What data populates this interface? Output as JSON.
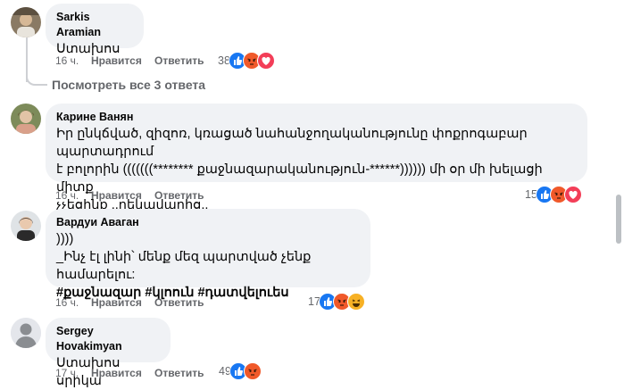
{
  "comments": [
    {
      "author": "Sarkis Aramian",
      "lines": [
        "Ստախոս"
      ],
      "time": "16 ч.",
      "like_label": "Нравится",
      "reply_label": "Ответить",
      "reaction_count": "38",
      "reactions": [
        "like-icon",
        "angry-icon",
        "love-icon"
      ]
    },
    {
      "author": "Карине Ванян",
      "lines": [
        "Իր ընկճված, զիզոռ, կռացած նահանջողականությունը փոքրոգաբար պարտադրում",
        "է բոլորին (((((((******** քաջնազարականություն-******)))))) մի օր մի խելացի միտք",
        "չչեցինք ,,ղեկավարից,,"
      ],
      "time": "16 ч.",
      "like_label": "Нравится",
      "reply_label": "Ответить",
      "reaction_count": "15",
      "reactions": [
        "like-icon",
        "angry-icon",
        "love-icon"
      ]
    },
    {
      "author": "Вардуи Аваган",
      "lines": [
        "))))",
        "_Ինչ էլ լինի՝ մենք մեզ պարտված չենք համարելու:"
      ],
      "hashtags": "#քաջնազար #կլոուն #դատվելուես",
      "time": "16 ч.",
      "like_label": "Нравится",
      "reply_label": "Ответить",
      "reaction_count": "17",
      "reactions": [
        "like-icon",
        "angry-icon",
        "haha-icon"
      ]
    },
    {
      "author": "Sergey Hovakimyan",
      "lines": [
        "Ստախոս սրիկա"
      ],
      "time": "17 ч.",
      "like_label": "Нравится",
      "reply_label": "Ответить",
      "reaction_count": "49",
      "reactions": [
        "like-icon",
        "angry-icon"
      ]
    }
  ],
  "view_replies_label": "Посмотреть все 3 ответа",
  "colors": {
    "bubble": "#f0f2f5",
    "like": "#1877f2",
    "angry": "#f0592a",
    "love": "#f33e58",
    "haha": "#f7b125",
    "meta_text": "#65676b"
  }
}
